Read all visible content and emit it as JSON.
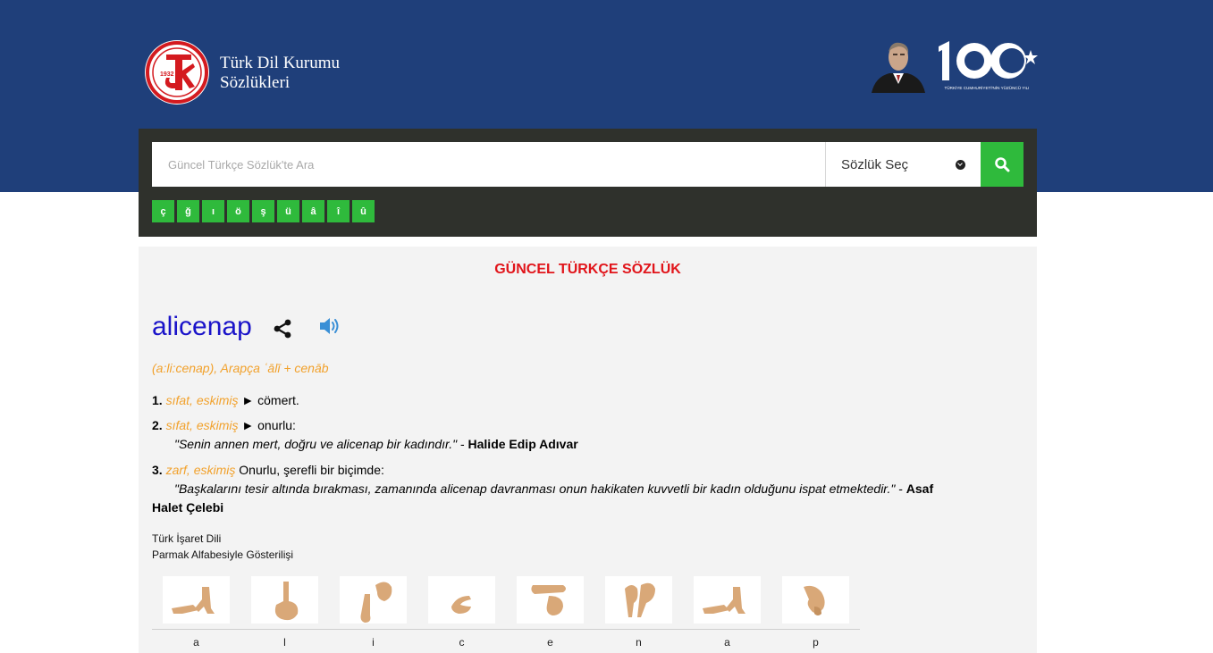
{
  "header": {
    "brand_line1": "Türk Dil Kurumu",
    "brand_line2": "Sözlükleri",
    "logo_year": "1932",
    "centennial_caption": "TÜRKİYE CUMHURİYETİ'NİN YÜZÜNCÜ YILI"
  },
  "search": {
    "placeholder": "Güncel Türkçe Sözlük'te Ara",
    "dict_select_label": "Sözlük Seç",
    "special_chars": [
      "ç",
      "ğ",
      "ı",
      "ö",
      "ş",
      "ü",
      "â",
      "î",
      "û"
    ]
  },
  "entry": {
    "dictionary_title": "GÜNCEL TÜRKÇE SÖZLÜK",
    "word": "alicenap",
    "origin": "(a:li:cenap), Arapça ʿālī + cenāb",
    "senses": [
      {
        "num": "1.",
        "tag": "sıfat, eskimiş",
        "arrow": "►",
        "meaning": "cömert."
      },
      {
        "num": "2.",
        "tag": "sıfat, eskimiş",
        "arrow": "►",
        "meaning": "onurlu:",
        "example": "\"Senin annen mert, doğru ve alicenap bir kadındır.\"",
        "author": "Halide Edip Adıvar"
      },
      {
        "num": "3.",
        "tag": "zarf, eskimiş",
        "meaning": "Onurlu, şerefli bir biçimde:",
        "example": "\"Başkalarını tesir altında bırakması, zamanında alicenap davranması onun hakikaten kuvvetli bir kadın olduğunu ispat etmektedir.\"",
        "author_line1": "Asaf",
        "author_line2": "Halet Çelebi"
      }
    ],
    "sign_language_title": "Türk İşaret Dili",
    "sign_language_subtitle": "Parmak Alfabesiyle Gösterilişi",
    "sign_letters": [
      "a",
      "l",
      "i",
      "c",
      "e",
      "n",
      "a",
      "p"
    ]
  },
  "colors": {
    "header_blue": "#1f3f7a",
    "accent_green": "#2fba3c",
    "title_red": "#e1141a",
    "word_blue": "#1a13c9",
    "tag_orange": "#f2a12b"
  }
}
